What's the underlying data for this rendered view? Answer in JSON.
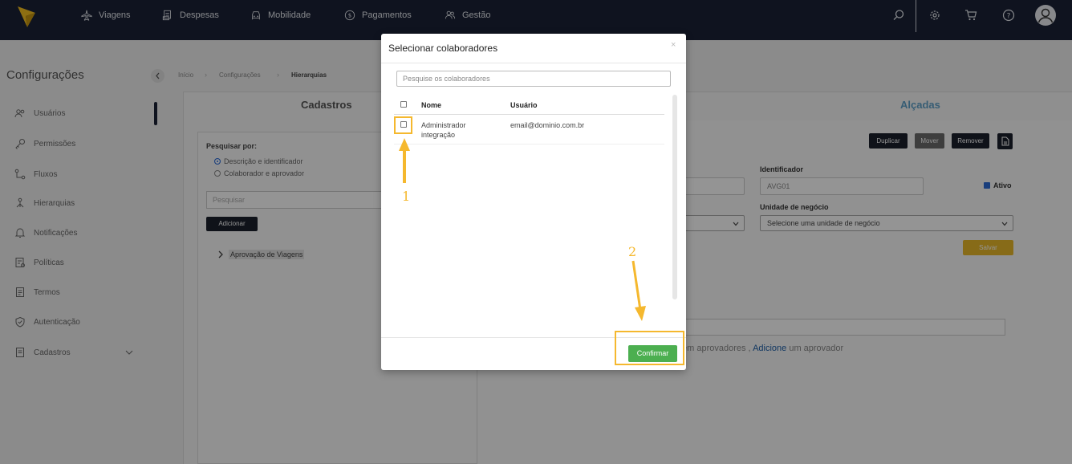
{
  "nav": {
    "items": [
      {
        "label": "Viagens",
        "icon": "airplane-icon"
      },
      {
        "label": "Despesas",
        "icon": "receipt-icon"
      },
      {
        "label": "Mobilidade",
        "icon": "car-icon"
      },
      {
        "label": "Pagamentos",
        "icon": "dollar-icon"
      },
      {
        "label": "Gestão",
        "icon": "people-icon"
      }
    ]
  },
  "page": {
    "title": "Configurações",
    "breadcrumb": [
      "Início",
      "Configurações",
      "Hierarquias"
    ]
  },
  "sidebar": {
    "items": [
      {
        "label": "Usuários"
      },
      {
        "label": "Permissões"
      },
      {
        "label": "Fluxos"
      },
      {
        "label": "Hierarquias"
      },
      {
        "label": "Notificações"
      },
      {
        "label": "Políticas"
      },
      {
        "label": "Termos"
      },
      {
        "label": "Autenticação"
      },
      {
        "label": "Cadastros"
      }
    ]
  },
  "tabs": {
    "cadastros": "Cadastros",
    "alcadas": "Alçadas"
  },
  "left_panel": {
    "search_by_label": "Pesquisar por:",
    "radio_1": "Descrição e identificador",
    "radio_2": "Colaborador e aprovador",
    "search_placeholder": "Pesquisar",
    "add_button": "Adicionar",
    "tree_item": "Aprovação de Viagens"
  },
  "right_panel": {
    "buttons": {
      "duplicar": "Duplicar",
      "mover": "Mover",
      "remover": "Remover"
    },
    "identificador_label": "Identificador",
    "identificador_value": "AVG01",
    "ativo_label": "Ativo",
    "unidade_label": "Unidade de negócio",
    "unidade_value": "Selecione uma unidade de negócio",
    "salvar": "Salvar",
    "hint_prefix": "em aprovadores , ",
    "hint_link": "Adicione",
    "hint_suffix": " um aprovador"
  },
  "modal": {
    "title": "Selecionar colaboradores",
    "close": "×",
    "search_placeholder": "Pesquise os colaboradores",
    "col_nome": "Nome",
    "col_usuario": "Usuário",
    "rows": [
      {
        "nome_line1": "Administrador",
        "nome_line2": "integração",
        "usuario": "email@dominio.com.br"
      }
    ],
    "confirm_button": "Confirmar"
  },
  "annotations": {
    "step1": "1",
    "step2": "2",
    "color": "#f5b82e"
  }
}
